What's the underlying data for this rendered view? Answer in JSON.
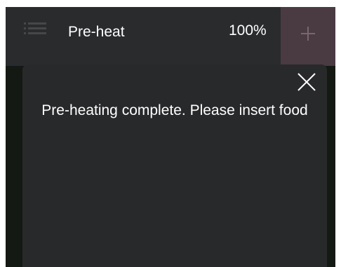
{
  "header": {
    "title": "Pre-heat",
    "progress_text": "100%",
    "menu_icon": "list-menu-icon",
    "add_icon": "plus-icon"
  },
  "notification": {
    "message": "Pre-heating complete. Please insert food",
    "close_icon": "close-icon"
  },
  "colors": {
    "background": "#151913",
    "header": "#2a2b2d",
    "modal": "#28292b",
    "accent": "#4a3a42",
    "text": "#ffffff"
  }
}
